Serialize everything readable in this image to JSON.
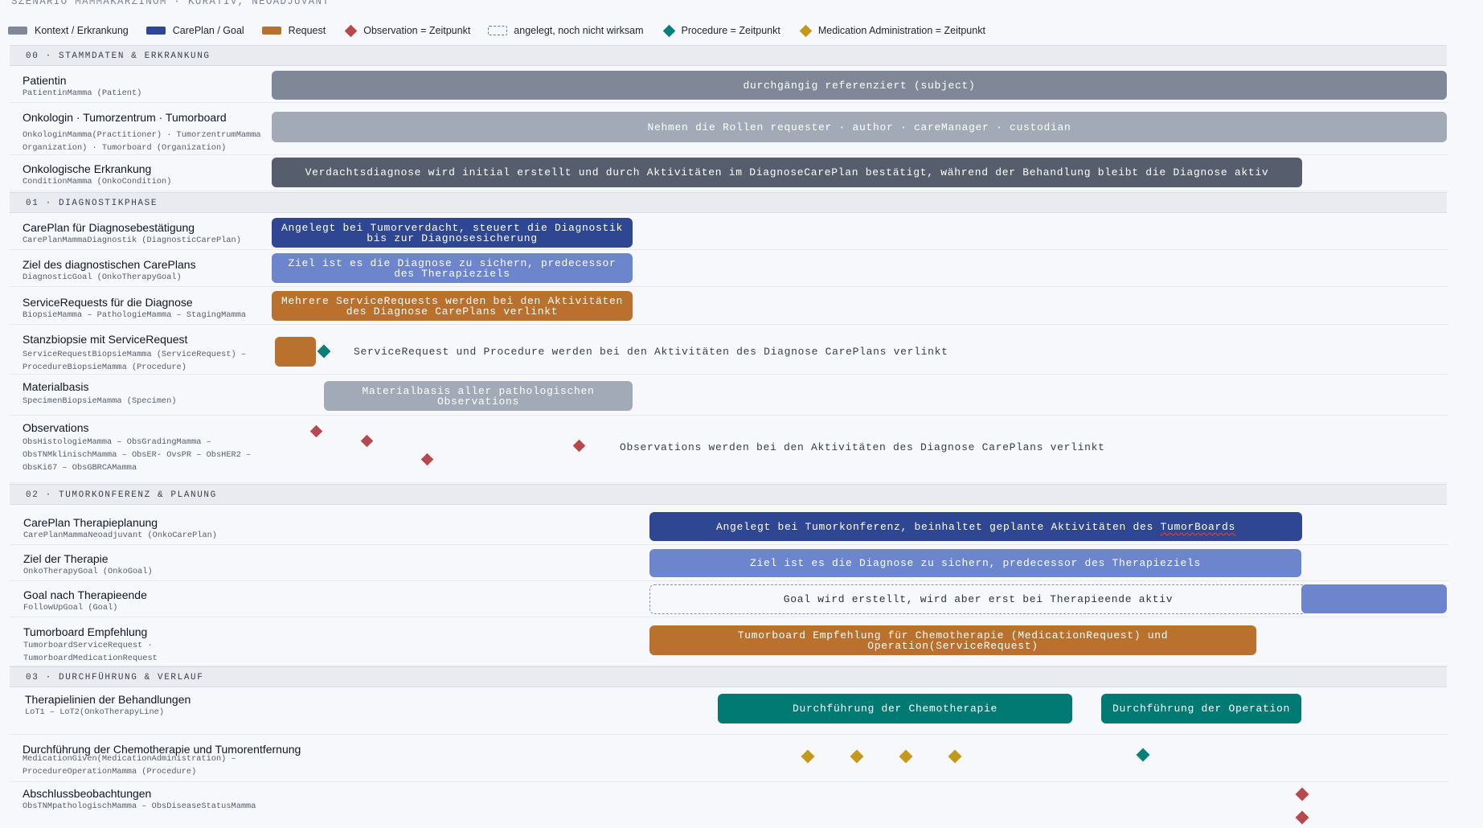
{
  "scenario_title": "SZENARIO MAMMAKARZINOM · KURATIV, NEOADJUVANT",
  "legend": {
    "kontext": "Kontext / Erkrankung",
    "careplan": "CarePlan / Goal",
    "request": "Request",
    "observation": "Observation = Zeitpunkt",
    "angelegt": "angelegt, noch nicht wirksam",
    "procedure": "Procedure = Zeitpunkt",
    "medication": "Medication Administration = Zeitpunkt"
  },
  "colors": {
    "kontext": "#808898",
    "careplan": "#2f4792",
    "goal": "#6c85cd",
    "request": "#b9712d",
    "procedure": "#017a74",
    "observation": "#b7484d",
    "medication": "#c4981a"
  },
  "sections": {
    "s00": "00 · STAMMDATEN & ERKRANKUNG",
    "s01": "01 · DIAGNOSTIKPHASE",
    "s02": "02 · TUMORKONFERENZ & PLANUNG",
    "s03": "03 · DURCHFÜHRUNG & VERLAUF"
  },
  "rows": {
    "patientin": {
      "title": "Patientin",
      "sub": "PatientinMamma (Patient)",
      "bar": "durchgängig referenziert (subject)"
    },
    "onkologin": {
      "title": "Onkologin · Tumorzentrum · Tumorboard",
      "sub": "OnkologinMamma(Practitioner) · TumorzentrumMamma Organization) · Tumorboard (Organization)",
      "bar": "Nehmen die Rollen requester · author · careManager · custodian"
    },
    "erkrankung": {
      "title": "Onkologische Erkrankung",
      "sub": "ConditionMamma (OnkoCondition)",
      "bar": "Verdachtsdiagnose wird initial erstellt und durch Aktivitäten im DiagnoseCarePlan bestätigt, während der Behandlung bleibt die Diagnose aktiv"
    },
    "careplan_diag": {
      "title": "CarePlan für Diagnosebestätigung",
      "sub": "CarePlanMammaDiagnostik (DiagnosticCarePlan)",
      "bar": "Angelegt bei Tumorverdacht, steuert die Diagnostik bis zur Diagnosesicherung"
    },
    "ziel_diag": {
      "title": "Ziel des diagnostischen CarePlans",
      "sub": "DiagnosticGoal (OnkoTherapyGoal)",
      "bar": "Ziel ist es die Diagnose zu sichern, predecessor des Therapieziels"
    },
    "servicerequests": {
      "title": "ServiceRequests für die Diagnose",
      "sub": "BiopsieMamma – PathologieMamma – StagingMamma",
      "bar": "Mehrere ServiceRequests werden bei den Aktivitäten des Diagnose CarePlans verlinkt"
    },
    "stanzbiopsie": {
      "title": "Stanzbiopsie mit ServiceRequest",
      "sub": "ServiceRequestBiopsieMamma (ServiceRequest) – ProcedureBiopsieMamma (Procedure)",
      "note": "ServiceRequest und Procedure werden bei den Aktivitäten des Diagnose CarePlans verlinkt"
    },
    "materialbasis": {
      "title": "Materialbasis",
      "sub": "SpecimenBiopsieMamma (Specimen)",
      "bar": "Materialbasis aller pathologischen Observations"
    },
    "observations": {
      "title": "Observations",
      "sub": "ObsHistologieMamma – ObsGradingMamma – ObsTNMklinischMamma – ObsER- OvsPR – ObsHER2 – ObsKi67 – ObsGBRCAMamma",
      "note": "Observations werden bei den Aktivitäten des Diagnose CarePlans verlinkt"
    },
    "careplan_ther": {
      "title": "CarePlan Therapieplanung",
      "sub": "CarePlanMammaNeoadjuvant (OnkoCarePlan)",
      "bar_prefix": "Angelegt bei Tumorkonferenz, beinhaltet geplante Aktivitäten des ",
      "bar_link": "TumorBoards"
    },
    "ziel_ther": {
      "title": "Ziel der Therapie",
      "sub": "OnkoTherapyGoal (OnkoGoal)",
      "bar": "Ziel ist es die Diagnose zu sichern, predecessor des Therapieziels"
    },
    "goal_ende": {
      "title": "Goal nach Therapieende",
      "sub": "FollowUpGoal (Goal)",
      "bar": "Goal wird erstellt, wird aber erst bei Therapieende aktiv"
    },
    "tumorboard": {
      "title": "Tumorboard Empfehlung",
      "sub": "TumorboardServiceRequest · TumorboardMedicationRequest",
      "bar": "Tumorboard Empfehlung für Chemotherapie (MedicationRequest) und Operation(ServiceRequest)"
    },
    "therapielinien": {
      "title": "Therapielinien der Behandlungen",
      "sub": "LoT1 – LoT2(OnkoTherapyLine)",
      "bar_chemo": "Durchführung der Chemotherapie",
      "bar_op": "Durchführung der Operation"
    },
    "durchfuehrung": {
      "title": "Durchführung der Chemotherapie und Tumorentfernung",
      "sub": "MedicationGiven(MedicationAdministration) – ProcedureOperationMamma (Procedure)"
    },
    "abschluss": {
      "title": "Abschlussbeobachtungen",
      "sub": "ObsTNMpathologischMamma – ObsDiseaseStatusMamma"
    }
  }
}
